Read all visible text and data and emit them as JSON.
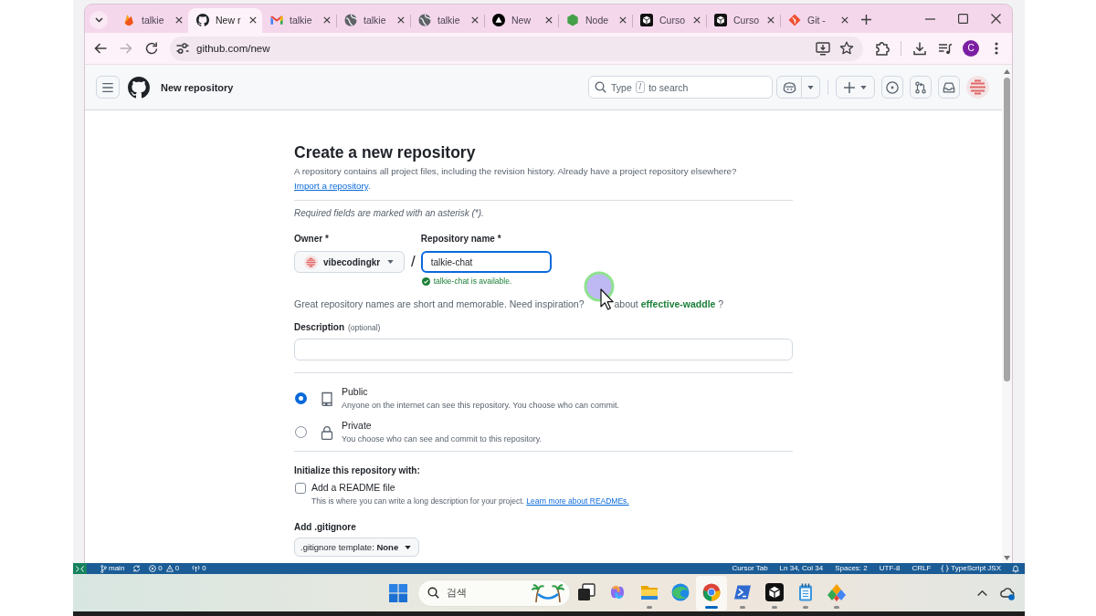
{
  "browser": {
    "tabs": [
      {
        "title": "talkie",
        "selected": false
      },
      {
        "title": "New r",
        "selected": true
      },
      {
        "title": "talkie",
        "selected": false
      },
      {
        "title": "talkie",
        "selected": false
      },
      {
        "title": "talkie",
        "selected": false
      },
      {
        "title": "New",
        "selected": false
      },
      {
        "title": "Node",
        "selected": false
      },
      {
        "title": "Curso",
        "selected": false
      },
      {
        "title": "Curso",
        "selected": false
      },
      {
        "title": "Git -",
        "selected": false
      }
    ],
    "forward_disabled": true,
    "address": "github.com/new",
    "profile_initial": "C"
  },
  "github_header": {
    "title": "New repository",
    "search": {
      "placeholder_start": "Type",
      "shortcut_key": "/",
      "placeholder_end": "to search"
    }
  },
  "form": {
    "heading": "Create a new repository",
    "intro": "A repository contains all project files, including the revision history. Already have a project repository elsewhere?",
    "import_link": "Import a repository",
    "import_link_end": ".",
    "required_note": "Required fields are marked with an asterisk (*).",
    "owner": {
      "label": "Owner *",
      "value": "vibecodingkr"
    },
    "separator": "/",
    "repository_name": {
      "label": "Repository name *",
      "value": "talkie-chat",
      "focused": true,
      "available": true,
      "message": "talkie-chat is available."
    },
    "suggestion": {
      "text": "Great repository names are short and memorable. Need inspiration?",
      "continuation": "about",
      "suggested_name": "effective-waddle",
      "end": "?"
    },
    "description": {
      "label": "Description",
      "note": "(optional)"
    },
    "visibility": [
      {
        "title": "Public",
        "description": "Anyone on the internet can see this repository. You choose who can commit.",
        "selected": true
      },
      {
        "title": "Private",
        "description": "You choose who can see and commit to this repository.",
        "selected": false
      }
    ],
    "initialize": {
      "heading": "Initialize this repository with:",
      "readme": {
        "label": "Add a README file",
        "checked": false,
        "hint": "This is where you can write a long description for your project.",
        "link": "Learn more about READMEs."
      }
    },
    "gitignore": {
      "label": "Add .gitignore",
      "dropdown": ".gitignore template: **None**"
    }
  },
  "editor_status_bar": {
    "branch": "main",
    "errors": "0",
    "warnings": "0",
    "ports": "0",
    "items": [
      "Cursor Tab",
      "Ln 34, Col 34",
      "Spaces: 2",
      "UTF-8",
      "CRLF",
      "TypeScript JSX"
    ]
  },
  "taskbar": {
    "search_placeholder": "검색",
    "apps": [
      {
        "selected": false,
        "running": false
      },
      {
        "selected": false,
        "running": false
      },
      {
        "selected": false,
        "running": true
      },
      {
        "selected": false,
        "running": false
      },
      {
        "selected": true,
        "running": true
      },
      {
        "selected": false,
        "running": true
      },
      {
        "selected": false,
        "running": true
      },
      {
        "selected": false,
        "running": true
      },
      {
        "selected": false,
        "running": true
      }
    ]
  }
}
